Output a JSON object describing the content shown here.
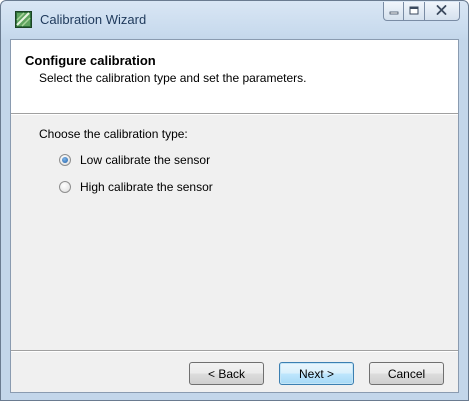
{
  "window": {
    "title": "Calibration Wizard"
  },
  "header": {
    "title": "Configure calibration",
    "subtitle": "Select the calibration type and set the parameters."
  },
  "content": {
    "prompt": "Choose the calibration type:",
    "options": [
      {
        "label": "Low calibrate the sensor",
        "selected": true
      },
      {
        "label": "High calibrate the sensor",
        "selected": false
      }
    ]
  },
  "buttons": {
    "back": "< Back",
    "next": "Next >",
    "cancel": "Cancel"
  },
  "icons": {
    "app": "calibration-wizard-icon",
    "minimize": "minimize-icon",
    "maximize": "maximize-icon",
    "close": "close-icon"
  },
  "colors": {
    "title_text": "#1e395b",
    "frame": "#c9dbee",
    "default_button_border": "#3c7fb1"
  }
}
